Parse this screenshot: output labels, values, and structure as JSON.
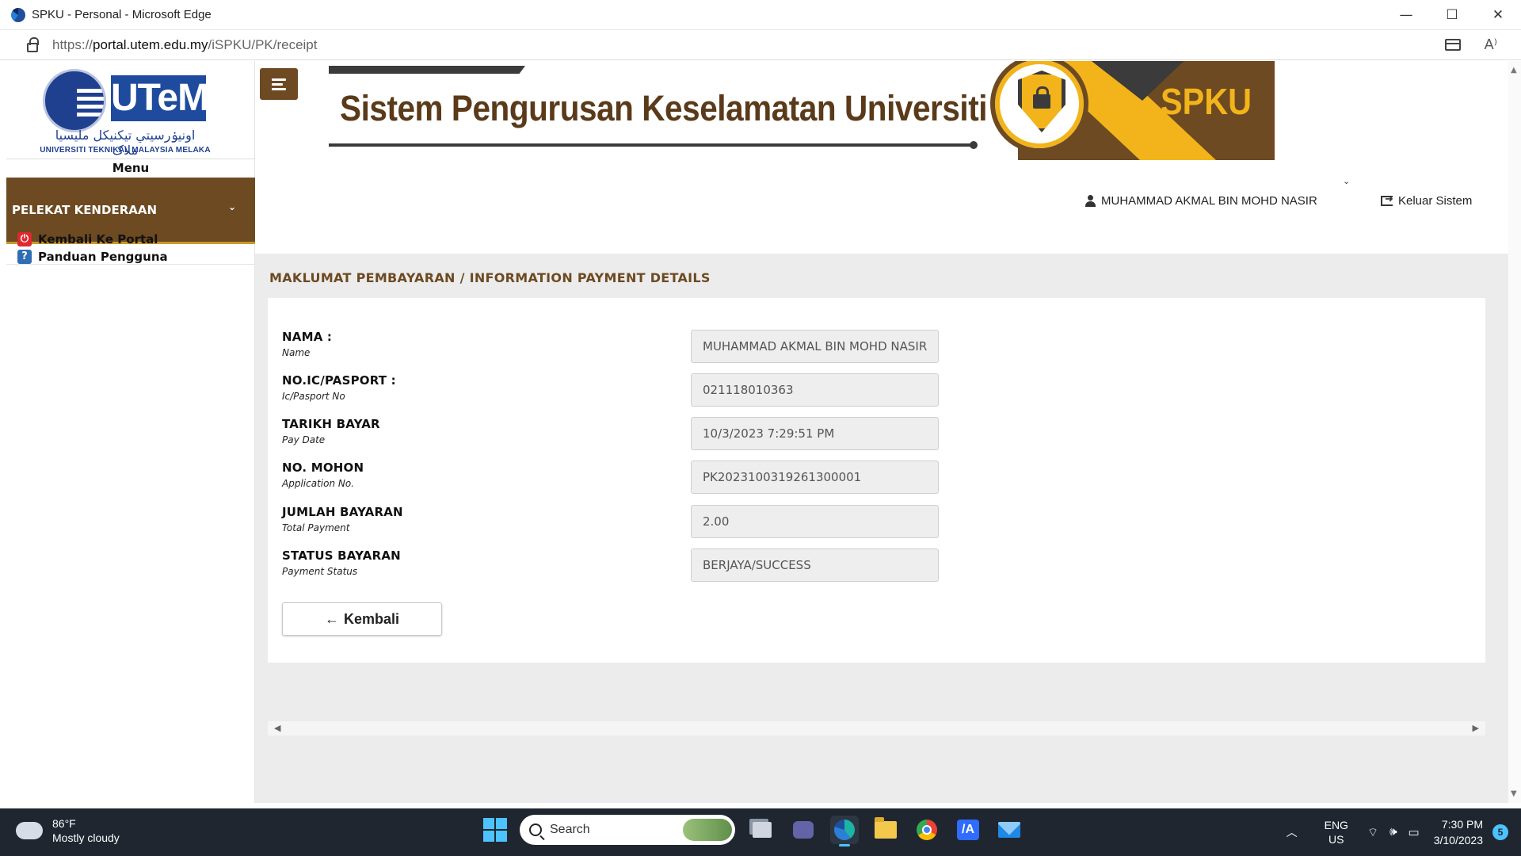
{
  "browser": {
    "title": "SPKU - Personal - Microsoft Edge",
    "url_prefix": "https://",
    "url_host": "portal.utem.edu.my",
    "url_path": "/iSPKU/PK/receipt",
    "controls": {
      "minimize": "—",
      "maximize": "☐",
      "close": "✕"
    }
  },
  "sidebar": {
    "logo": {
      "wordmark": "UTeM",
      "jawi": "اونيۏرسيتي تيكنيکل مليسيا ملاک",
      "subtitle": "UNIVERSITI TEKNIKAL MALAYSIA MELAKA"
    },
    "menu_label": "Menu",
    "nav_item": "PELEKAT KENDERAAN",
    "links": [
      {
        "label": "Kembali Ke Portal",
        "icon": "power-icon"
      },
      {
        "label": "Panduan Pengguna",
        "icon": "help-icon"
      }
    ]
  },
  "banner": {
    "title": "Sistem Pengurusan Keselamatan Universiti",
    "acronym": "SPKU",
    "colors": {
      "brown": "#6d4a22",
      "gold": "#f2b41a",
      "dark": "#3b3b3b"
    }
  },
  "header": {
    "user_name": "MUHAMMAD AKMAL BIN MOHD NASIR",
    "logout_label": "Keluar Sistem"
  },
  "content": {
    "title": "MAKLUMAT PEMBAYARAN / INFORMATION PAYMENT DETAILS",
    "fields": [
      {
        "label": "NAMA :",
        "sublabel": "Name",
        "value": "MUHAMMAD AKMAL BIN MOHD NASIR"
      },
      {
        "label": "NO.IC/PASPORT :",
        "sublabel": "Ic/Pasport No",
        "value": "021118010363"
      },
      {
        "label": "TARIKH BAYAR",
        "sublabel": "Pay Date",
        "value": "10/3/2023 7:29:51 PM"
      },
      {
        "label": "NO. MOHON",
        "sublabel": "Application No.",
        "value": "PK2023100319261300001"
      },
      {
        "label": "JUMLAH BAYARAN",
        "sublabel": "Total Payment",
        "value": "2.00"
      },
      {
        "label": "STATUS BAYARAN",
        "sublabel": "Payment Status",
        "value": "BERJAYA/SUCCESS"
      }
    ],
    "back_button": "Kembali"
  },
  "taskbar": {
    "weather_temp": "86°F",
    "weather_desc": "Mostly cloudy",
    "search_label": "Search",
    "lang_top": "ENG",
    "lang_bottom": "US",
    "time": "7:30 PM",
    "date": "3/10/2023",
    "notification_count": "5"
  }
}
